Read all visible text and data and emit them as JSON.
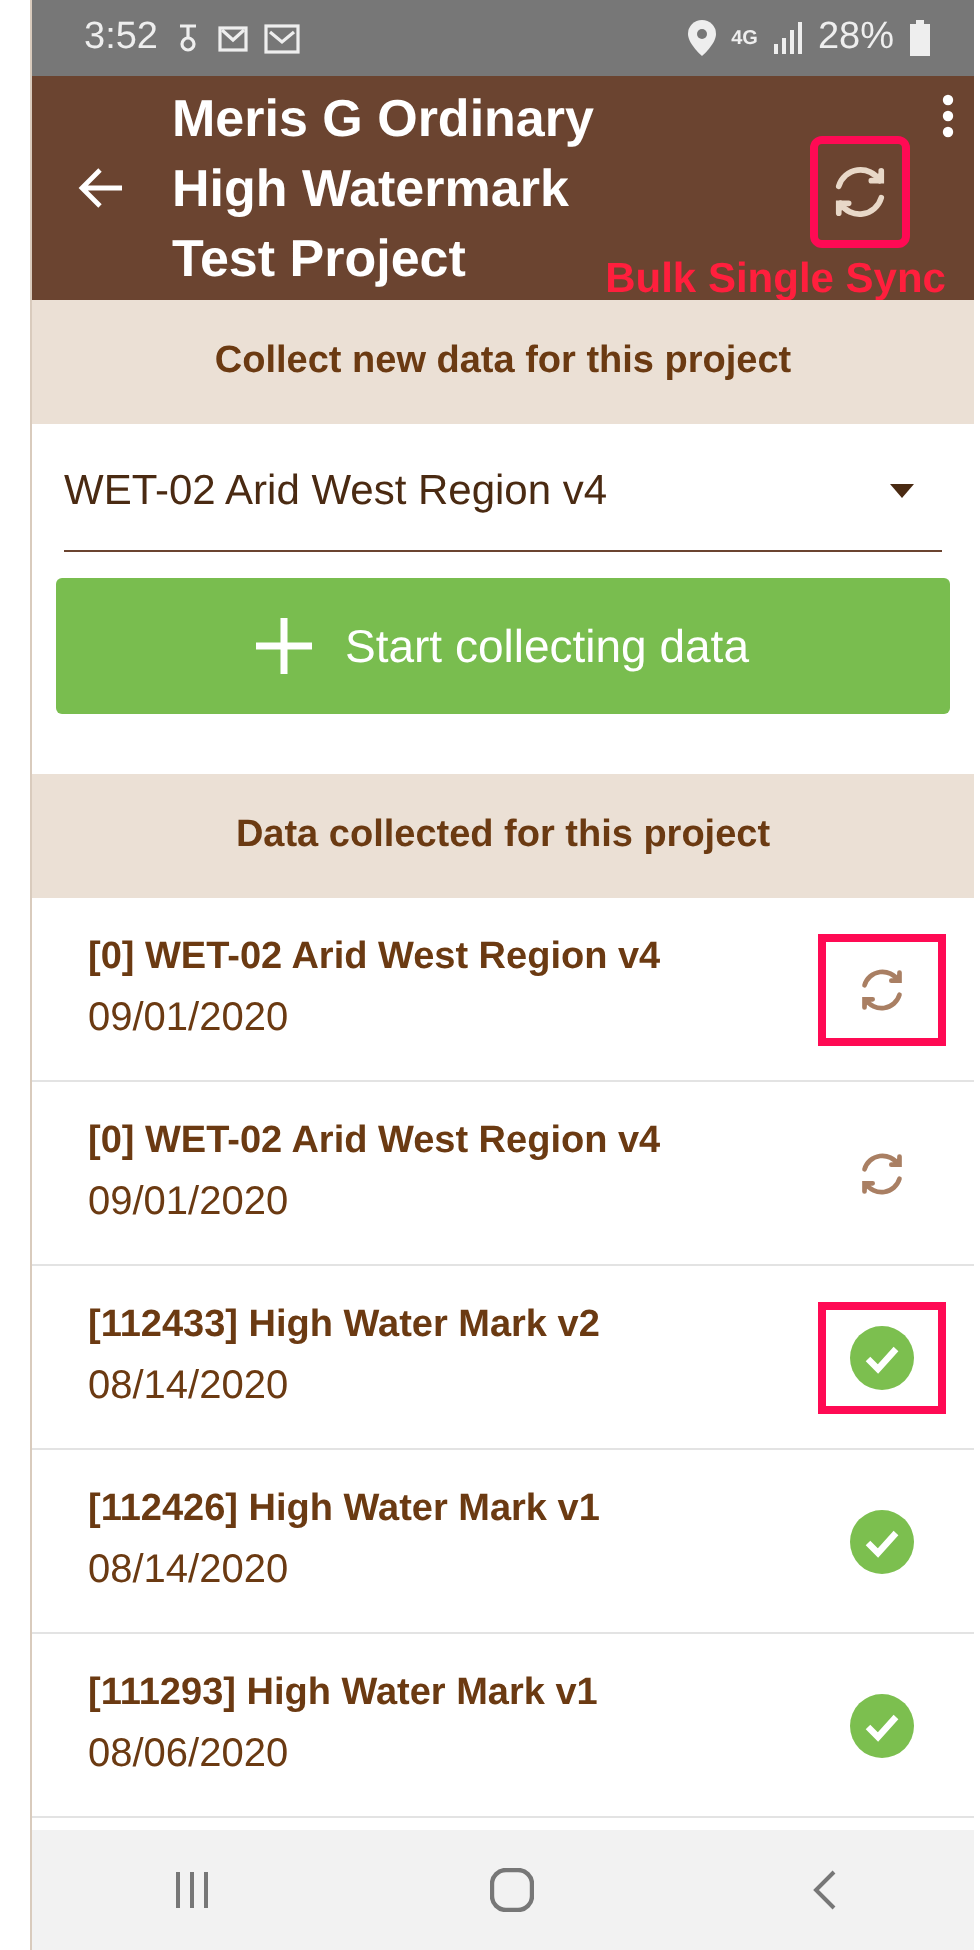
{
  "status_bar": {
    "time": "3:52",
    "network": "4G",
    "battery": "28%"
  },
  "header": {
    "title": "Meris G Ordinary High Watermark Test Project",
    "sync_highlighted": true,
    "annotation": "Bulk Single Sync"
  },
  "collect_section": {
    "heading": "Collect new data for this project",
    "dropdown_value": "WET-02 Arid West Region v4",
    "button_label": "Start collecting data"
  },
  "collected_section": {
    "heading": "Data collected for this project"
  },
  "records": [
    {
      "title": "[0] WET-02 Arid West Region v4",
      "date": "09/01/2020",
      "kind": "pending",
      "highlighted": true
    },
    {
      "title": "[0] WET-02 Arid West Region v4",
      "date": "09/01/2020",
      "kind": "pending",
      "highlighted": false
    },
    {
      "title": "[112433] High Water Mark v2",
      "date": "08/14/2020",
      "kind": "synced",
      "highlighted": true
    },
    {
      "title": "[112426] High Water Mark v1",
      "date": "08/14/2020",
      "kind": "synced",
      "highlighted": false
    },
    {
      "title": "[111293] High Water Mark v1",
      "date": "08/06/2020",
      "kind": "synced",
      "highlighted": false
    }
  ]
}
